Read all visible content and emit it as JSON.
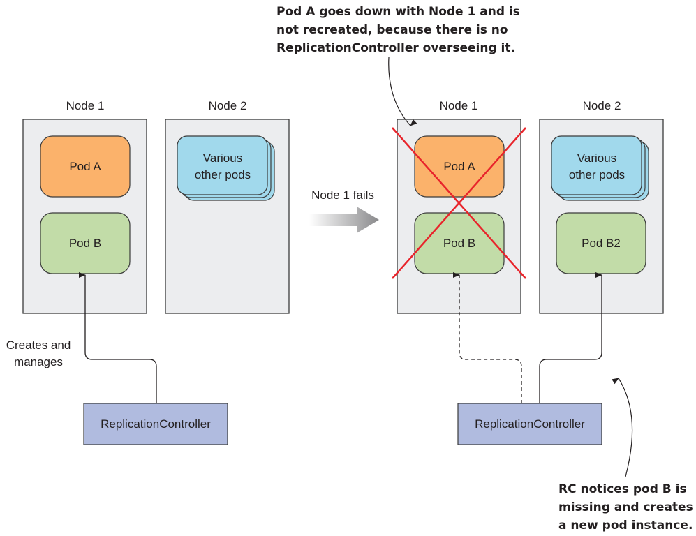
{
  "colors": {
    "node_fill": "#ecedef",
    "node_stroke": "#3b3b3b",
    "pod_a": "#fbb26b",
    "pod_b": "#c2dca8",
    "other_pods": "#a1d9ec",
    "rc_fill": "#b0bbdf",
    "cross": "#e8242b"
  },
  "before": {
    "node1": {
      "label": "Node 1",
      "pods": [
        "Pod A",
        "Pod B"
      ]
    },
    "node2": {
      "label": "Node 2",
      "other_pods": [
        "Various",
        "other pods"
      ]
    },
    "edge_label": [
      "Creates and",
      "manages"
    ],
    "controller": "ReplicationController"
  },
  "transition": {
    "label": "Node 1 fails"
  },
  "after": {
    "node1": {
      "label": "Node 1",
      "pods": [
        "Pod A",
        "Pod B"
      ],
      "failed": true
    },
    "node2": {
      "label": "Node 2",
      "other_pods": [
        "Various",
        "other pods"
      ],
      "new_pod": "Pod B2"
    },
    "controller": "ReplicationController"
  },
  "annotations": {
    "top": [
      "Pod A goes down with Node 1 and is",
      "not recreated, because there is no",
      "ReplicationController overseeing it."
    ],
    "bottom": [
      "RC notices pod B is",
      "missing and creates",
      "a new pod instance."
    ]
  }
}
